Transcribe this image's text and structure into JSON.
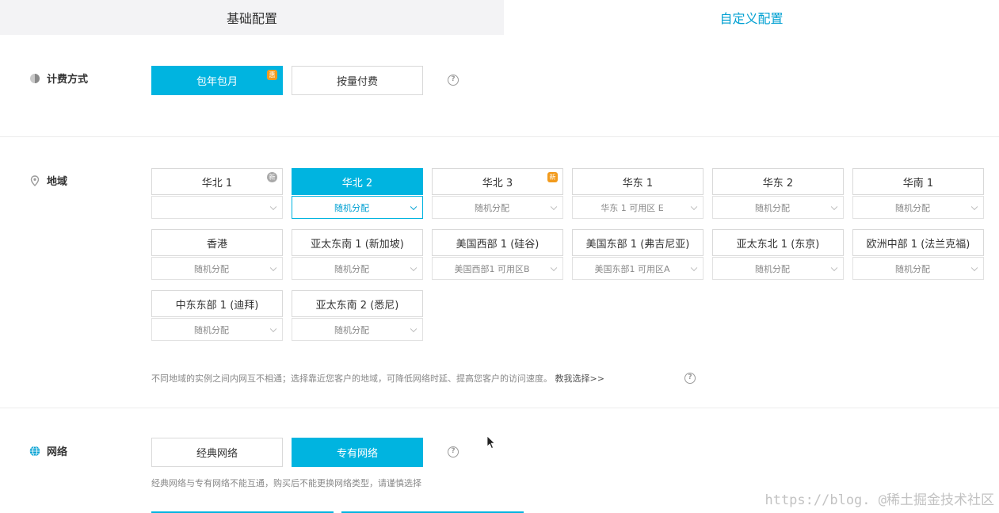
{
  "tabs": {
    "basic": "基础配置",
    "custom": "自定义配置"
  },
  "billing": {
    "label": "计费方式",
    "options": [
      {
        "label": "包年包月",
        "badge": "惠",
        "selected": true
      },
      {
        "label": "按量付费",
        "selected": false
      }
    ]
  },
  "region": {
    "label": "地域",
    "items": [
      {
        "name": "华北 1",
        "zone": "",
        "badge": "新",
        "badge_style": "gray"
      },
      {
        "name": "华北 2",
        "zone": "随机分配",
        "selected": true
      },
      {
        "name": "华北 3",
        "zone": "随机分配",
        "badge": "新"
      },
      {
        "name": "华东 1",
        "zone": "华东 1 可用区 E"
      },
      {
        "name": "华东 2",
        "zone": "随机分配"
      },
      {
        "name": "华南 1",
        "zone": "随机分配"
      },
      {
        "name": "香港",
        "zone": "随机分配"
      },
      {
        "name": "亚太东南 1 (新加坡)",
        "zone": "随机分配"
      },
      {
        "name": "美国西部 1 (硅谷)",
        "zone": "美国西部1 可用区B"
      },
      {
        "name": "美国东部 1 (弗吉尼亚)",
        "zone": "美国东部1 可用区A"
      },
      {
        "name": "亚太东北 1 (东京)",
        "zone": "随机分配"
      },
      {
        "name": "欧洲中部 1 (法兰克福)",
        "zone": "随机分配"
      },
      {
        "name": "中东东部 1 (迪拜)",
        "zone": "随机分配"
      },
      {
        "name": "亚太东南 2 (悉尼)",
        "zone": "随机分配"
      }
    ],
    "note": "不同地域的实例之间内网互不相通；选择靠近您客户的地域，可降低网络时延、提高您客户的访问速度。",
    "note_link": "教我选择>>"
  },
  "network": {
    "label": "网络",
    "options": [
      {
        "label": "经典网络",
        "selected": false
      },
      {
        "label": "专有网络",
        "selected": true
      }
    ],
    "note": "经典网络与专有网络不能互通，购买后不能更换网络类型，请谨慎选择"
  },
  "help_glyph": "?",
  "watermark": "https://blog. @稀土掘金技术社区",
  "colors": {
    "accent": "#00b4e0",
    "badge": "#f29b1d",
    "tab_active_text": "#00a0d2"
  }
}
